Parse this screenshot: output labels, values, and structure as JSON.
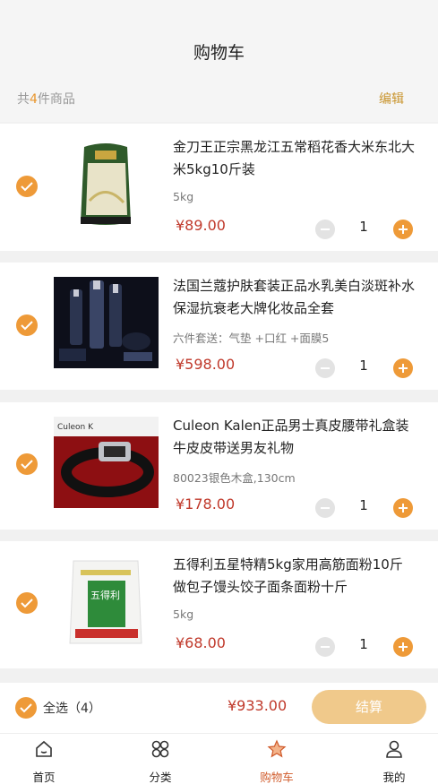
{
  "header": {
    "title": "购物车"
  },
  "summary": {
    "prefix": "共",
    "count": "4",
    "suffix": "件商品",
    "edit": "编辑"
  },
  "items": [
    {
      "name": "金刀王正宗黑龙江五常稻花香大米东北大米5kg10斤装",
      "spec": "5kg",
      "price": "¥89.00",
      "qty": "1"
    },
    {
      "name": "法国兰蔻护肤套装正品水乳美白淡斑补水保湿抗衰老大牌化妆品全套",
      "spec": "六件套送：气垫 +口红 +面膜5",
      "price": "¥598.00",
      "qty": "1"
    },
    {
      "name": "Culeon Kalen正品男士真皮腰带礼盒装牛皮皮带送男友礼物",
      "spec": "80023银色木盒,130cm",
      "price": "¥178.00",
      "qty": "1",
      "image_text": "Culeon K"
    },
    {
      "name": "五得利五星特精5kg家用高筋面粉10斤做包子馒头饺子面条面粉十斤",
      "spec": "5kg",
      "price": "¥68.00",
      "qty": "1",
      "image_text": "五得利"
    }
  ],
  "footer": {
    "select_all": "全选（4）",
    "total": "¥933.00",
    "settle": "结算"
  },
  "tabs": [
    {
      "label": "首页",
      "icon": "home-icon"
    },
    {
      "label": "分类",
      "icon": "category-icon"
    },
    {
      "label": "购物车",
      "icon": "cart-star-icon"
    },
    {
      "label": "我的",
      "icon": "user-icon"
    }
  ],
  "colors": {
    "accent": "#ee9a38",
    "price": "#c0392b",
    "active_tab": "#d05a2a"
  }
}
